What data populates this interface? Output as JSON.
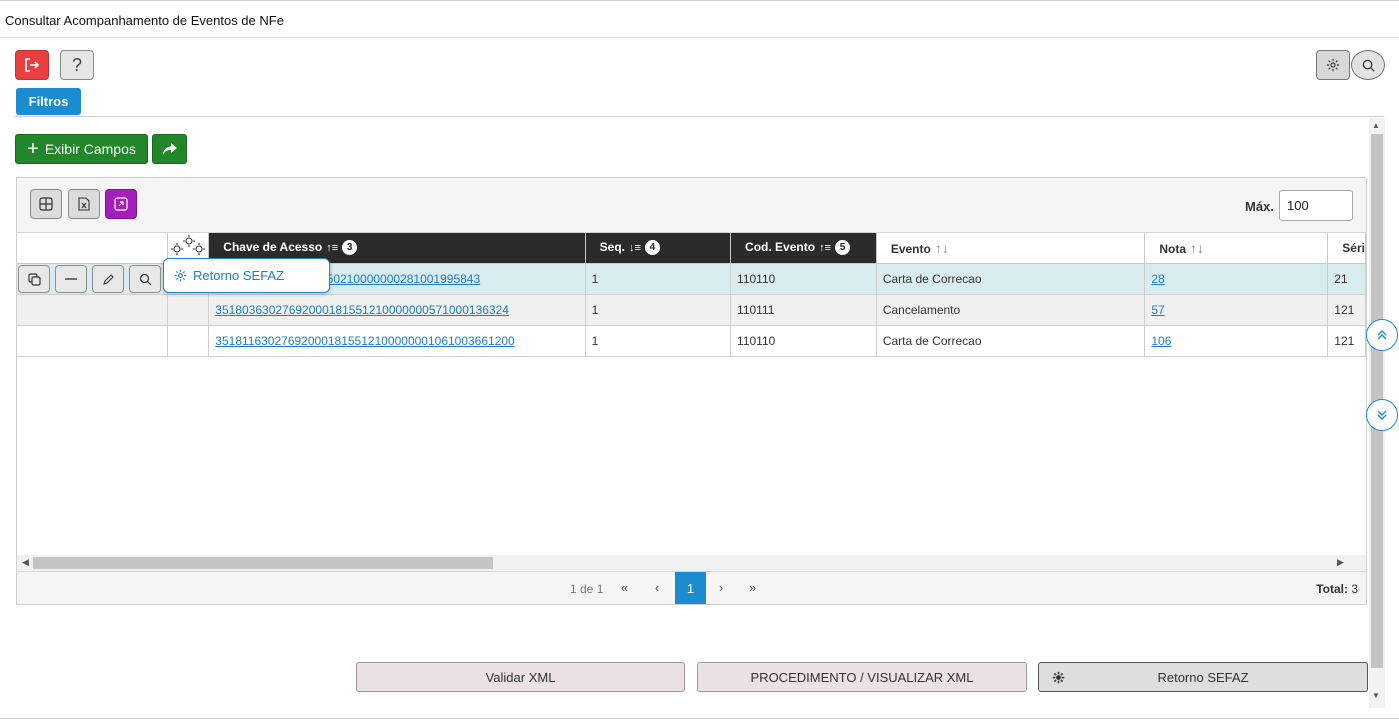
{
  "window": {
    "title": "Consultar Acompanhamento de Eventos de NFe"
  },
  "toolbar": {
    "exit_icon": "exit-icon",
    "help_label": "?",
    "filtros_label": "Filtros"
  },
  "actions": {
    "exibir_campos_label": "Exibir Campos",
    "plus": "+"
  },
  "grid": {
    "max_label": "Máx.",
    "max_value": "100",
    "columns": {
      "chave": "Chave de Acesso",
      "chave_badge": "3",
      "seq": "Seq.",
      "seq_badge": "4",
      "cod": "Cod. Evento",
      "cod_badge": "5",
      "evento": "Evento",
      "nota": "Nota",
      "serie": "Séri"
    },
    "rows": [
      {
        "chave": "3518036302769200018155021000000028100199584​3",
        "chave_visible": "155021000000028100199584​3",
        "seq": "1",
        "cod": "110110",
        "evento": "Carta de Correcao",
        "nota": "28",
        "serie": "21"
      },
      {
        "chave": "35180363027692000181551210000000571000136324",
        "seq": "1",
        "cod": "110111",
        "evento": "Cancelamento",
        "nota": "57",
        "serie": "121"
      },
      {
        "chave": "35181163027692000181551210000000106100366120​0",
        "seq": "1",
        "cod": "110110",
        "evento": "Carta de Correcao",
        "nota": "106",
        "serie": "121"
      }
    ],
    "popup_label": "Retorno SEFAZ",
    "pager": {
      "info": "1 de 1",
      "first": "«",
      "prev": "‹",
      "current": "1",
      "next": "›",
      "last": "»",
      "total_label": "Total:",
      "total_value": "3"
    }
  },
  "bottom": {
    "validar": "Validar XML",
    "procedimento": "PROCEDIMENTO / VISUALIZAR XML",
    "retorno": "Retorno SEFAZ"
  }
}
